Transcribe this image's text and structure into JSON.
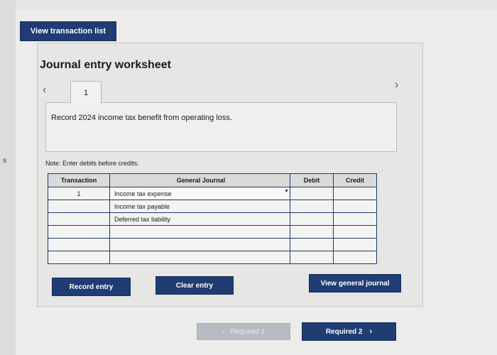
{
  "left_mark": "s",
  "buttons": {
    "view_transaction_list": "View transaction list",
    "record_entry": "Record entry",
    "clear_entry": "Clear entry",
    "view_general_journal": "View general journal",
    "required_prev": "Required 1",
    "required_next": "Required 2"
  },
  "worksheet": {
    "title": "Journal entry worksheet",
    "active_tab": "1",
    "description": "Record 2024 income tax benefit from operating loss.",
    "note": "Note: Enter debits before credits."
  },
  "table": {
    "headers": [
      "Transaction",
      "General Journal",
      "Debit",
      "Credit"
    ],
    "rows": [
      {
        "transaction": "1",
        "account": "Income tax expense",
        "debit": "",
        "credit": ""
      },
      {
        "transaction": "",
        "account": "Income tax payable",
        "debit": "",
        "credit": ""
      },
      {
        "transaction": "",
        "account": "Deferred tax liability",
        "debit": "",
        "credit": ""
      },
      {
        "transaction": "",
        "account": "",
        "debit": "",
        "credit": ""
      },
      {
        "transaction": "",
        "account": "",
        "debit": "",
        "credit": ""
      },
      {
        "transaction": "",
        "account": "",
        "debit": "",
        "credit": ""
      }
    ]
  },
  "icons": {
    "prev": "chevron-left-icon",
    "next": "chevron-right-icon",
    "dropdown": "caret-down-icon"
  },
  "colors": {
    "primary_button": "#1f3d73",
    "disabled_button": "#b7bcc3",
    "table_border": "#1e3a6e"
  }
}
